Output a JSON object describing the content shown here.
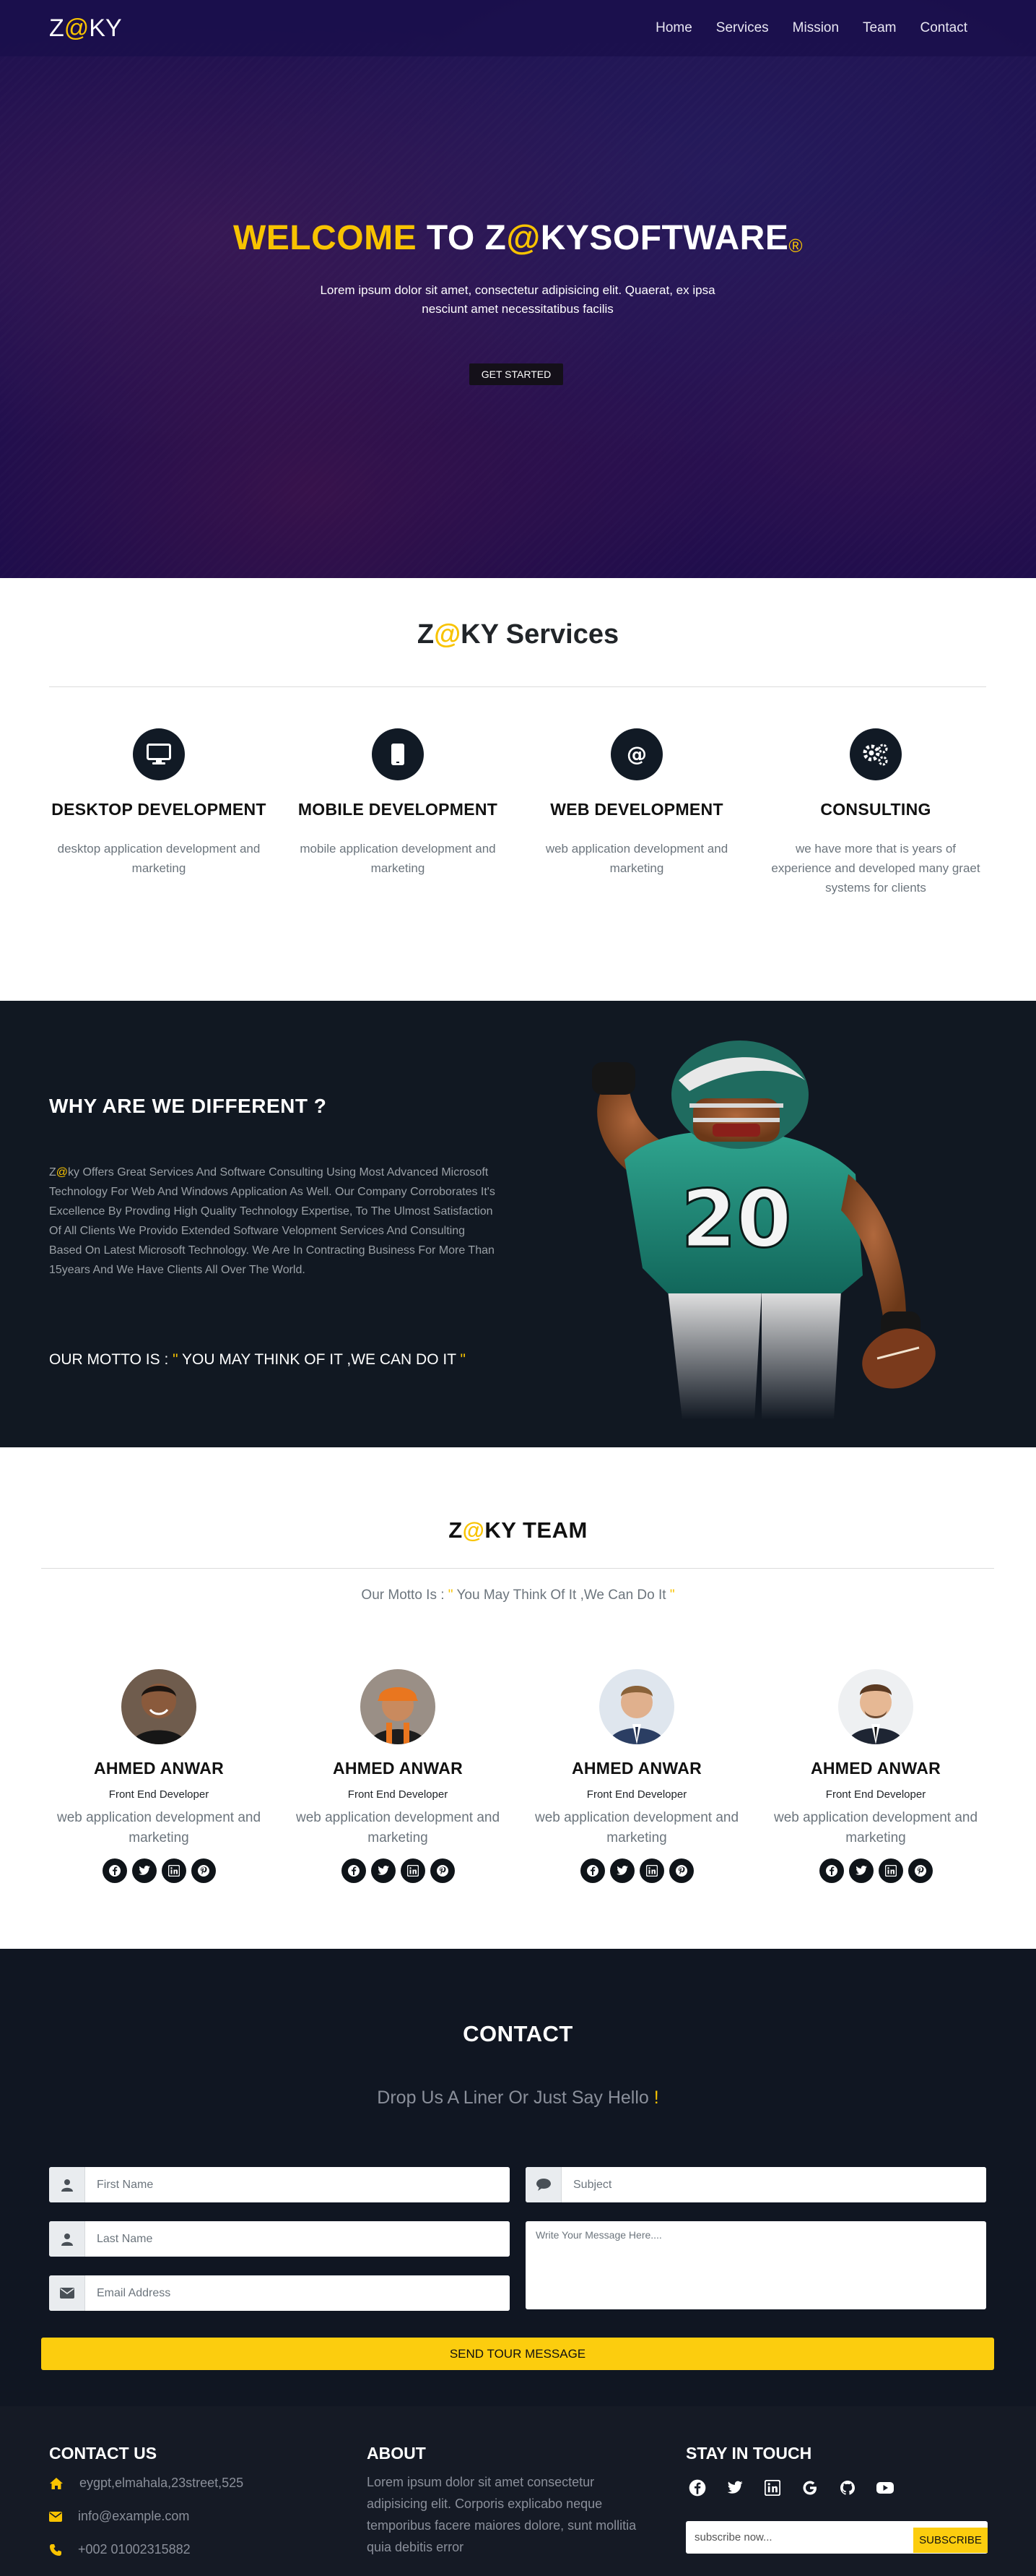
{
  "colors": {
    "accent": "#f8c300",
    "dark": "#111822",
    "button_yellow": "#fccd0e"
  },
  "navbar": {
    "brand_prefix": "Z",
    "brand_at": "@",
    "brand_suffix": "KY",
    "links": [
      "Home",
      "Services",
      "Mission",
      "Team",
      "Contact"
    ]
  },
  "hero": {
    "title_highlight": "WELCOME",
    "title_rest": " TO Z",
    "title_at": "@",
    "title_end": "KYSOFTWARE",
    "title_reg": "®",
    "subtitle": "Lorem ipsum dolor sit amet, consectetur adipisicing elit. Quaerat, ex ipsa nesciunt amet necessitatibus facilis",
    "button": "GET STARTED"
  },
  "services": {
    "title_prefix": "Z",
    "title_at": "@",
    "title_suffix": "KY Services",
    "items": [
      {
        "icon": "desktop-icon",
        "title": "DESKTOP DEVELOPMENT",
        "text": "desktop application development and marketing"
      },
      {
        "icon": "mobile-icon",
        "title": "MOBILE DEVELOPMENT",
        "text": "mobile application development and marketing"
      },
      {
        "icon": "at-icon",
        "title": "WEB DEVELOPMENT",
        "text": "web application development and marketing"
      },
      {
        "icon": "cogs-icon",
        "title": "CONSULTING",
        "text": "we have more that is years of experience and developed many graet systems for clients"
      }
    ]
  },
  "different": {
    "title": "WHY ARE WE DIFFERENT ?",
    "text_prefix": "Z",
    "text_at": "@",
    "text_body": "ky Offers Great Services And Software Consulting Using Most Advanced Microsoft Technology For Web And Windows Application As Well. Our Company Corroborates It's Excellence By Provding High Quality Technology Expertise, To The Ulmost Satisfaction Of All Clients We Provido Extended Software Velopment Services And Consulting Based On Latest Microsoft Technology. We Are In Contracting Business For More Than 15years And We Have Clients All Over The World.",
    "motto_label": "OUR MOTTO IS : ",
    "motto_open": "\"",
    "motto_text": " YOU MAY THINK OF IT ,WE CAN DO IT ",
    "motto_close": "\"",
    "jersey_number": "20"
  },
  "team": {
    "title_prefix": "Z",
    "title_at": "@",
    "title_suffix": "KY TEAM",
    "motto_label": "Our Motto Is : ",
    "motto_open": "\"",
    "motto_text": " You May Think Of It ,We Can Do It ",
    "motto_close": "\"",
    "members": [
      {
        "name": "AHMED ANWAR",
        "role": "Front End Developer",
        "desc": "web application development and marketing"
      },
      {
        "name": "AHMED ANWAR",
        "role": "Front End Developer",
        "desc": "web application development and marketing"
      },
      {
        "name": "AHMED ANWAR",
        "role": "Front End Developer",
        "desc": "web application development and marketing"
      },
      {
        "name": "AHMED ANWAR",
        "role": "Front End Developer",
        "desc": "web application development and marketing"
      }
    ],
    "social_icons": [
      "facebook-icon",
      "twitter-icon",
      "linkedin-icon",
      "pinterest-icon"
    ]
  },
  "contact": {
    "title": "CONTACT",
    "subtitle": "Drop Us A Liner Or Just Say Hello ",
    "subtitle_bang": "!",
    "first_name_placeholder": "First Name",
    "last_name_placeholder": "Last Name",
    "email_placeholder": "Email Address",
    "subject_placeholder": "Subject",
    "message_placeholder": "Write Your Message Here....",
    "send_button": "SEND TOUR MESSAGE"
  },
  "footer": {
    "contact_title": "CONTACT US",
    "address": "eygpt,elmahala,23street,525",
    "email": "info@example.com",
    "phone": "+002 01002315882",
    "about_title": "ABOUT",
    "about_text": "Lorem ipsum dolor sit amet consectetur adipisicing elit. Corporis explicabo neque temporibus facere maiores dolore, sunt mollitia quia debitis error",
    "stay_title": "STAY IN TOUCH",
    "social_icons": [
      "facebook-icon",
      "twitter-icon",
      "linkedin-icon",
      "google-icon",
      "github-icon",
      "youtube-icon"
    ],
    "subscribe_placeholder": "subscribe now...",
    "subscribe_button": "SUBSCRIBE"
  }
}
